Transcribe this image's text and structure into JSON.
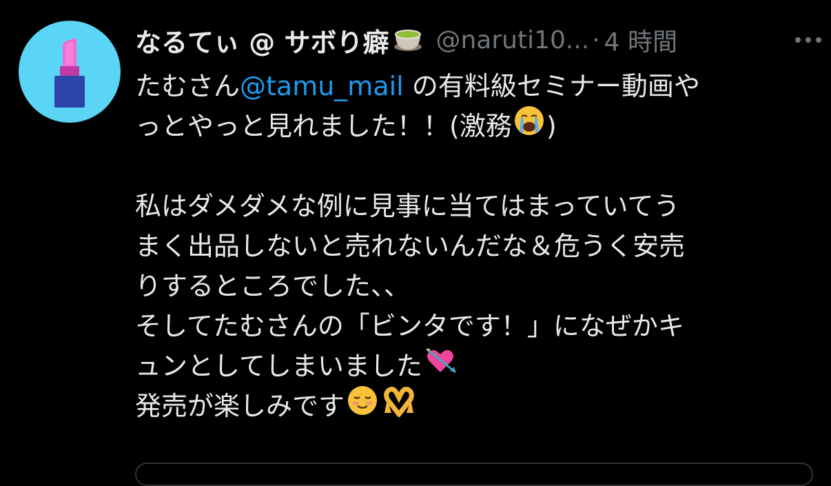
{
  "tweet": {
    "display_name": "なるてぃ @ サボり癖",
    "name_emoji": "tea-cup",
    "handle": "@naruti10...",
    "separator": "·",
    "time": "4 時間",
    "mention_prefix": "たむさん",
    "mention": "@tamu_mail",
    "line1_suffix": " の有料級セミナー動画や",
    "line2_text": "っとやっと見れました！！(激務",
    "line2_close": ")",
    "line4": "私はダメダメな例に見事に当てはまっていてう",
    "line5": "まく出品しないと売れないんだな＆危うく安売",
    "line6": "りするところでした、、",
    "line7": "そしてたむさんの「ビンタです！」になぜかキ",
    "line8": "ュンとしてしまいました",
    "line9": "発売が楽しみです",
    "colors": {
      "background": "#000000",
      "text": "#e7e9ea",
      "muted": "#71767b",
      "mention": "#1d9bf0",
      "avatar_bg": "#5ad5f5"
    }
  }
}
